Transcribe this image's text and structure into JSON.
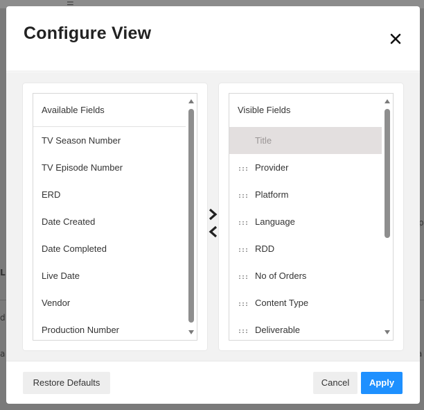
{
  "background": {
    "edge_texts": [
      "L",
      "d",
      "a",
      "a",
      "p"
    ]
  },
  "dialog": {
    "title": "Configure View",
    "close_label": "×"
  },
  "available": {
    "header": "Available Fields",
    "items": [
      "TV Season Number",
      "TV Episode Number",
      "ERD",
      "Date Created",
      "Date Completed",
      "Live Date",
      "Vendor",
      "Production Number"
    ]
  },
  "visible": {
    "header": "Visible Fields",
    "handle": ":::",
    "items": [
      {
        "label": "Title",
        "selected": true
      },
      {
        "label": "Provider"
      },
      {
        "label": "Platform"
      },
      {
        "label": "Language"
      },
      {
        "label": "RDD"
      },
      {
        "label": "No of Orders"
      },
      {
        "label": "Content Type"
      },
      {
        "label": "Deliverable"
      }
    ]
  },
  "footer": {
    "restore_label": "Restore Defaults",
    "cancel_label": "Cancel",
    "apply_label": "Apply"
  },
  "colors": {
    "accent": "#1e90ff",
    "selected_row": "#e3dfdf",
    "overlay": "#7a7a7a"
  },
  "icons": {
    "close": "close-icon",
    "move_right": "chevron-right-icon",
    "move_left": "chevron-left-icon",
    "drag": "drag-handle-icon"
  }
}
